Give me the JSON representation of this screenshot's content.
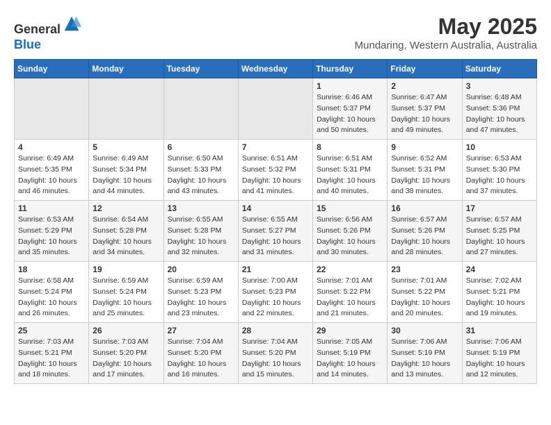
{
  "header": {
    "logo_line1": "General",
    "logo_line2": "Blue",
    "title": "May 2025",
    "subtitle": "Mundaring, Western Australia, Australia"
  },
  "weekdays": [
    "Sunday",
    "Monday",
    "Tuesday",
    "Wednesday",
    "Thursday",
    "Friday",
    "Saturday"
  ],
  "weeks": [
    [
      {
        "day": "",
        "empty": true
      },
      {
        "day": "",
        "empty": true
      },
      {
        "day": "",
        "empty": true
      },
      {
        "day": "",
        "empty": true
      },
      {
        "day": "1",
        "sunrise": "6:46 AM",
        "sunset": "5:37 PM",
        "daylight": "10 hours and 50 minutes."
      },
      {
        "day": "2",
        "sunrise": "6:47 AM",
        "sunset": "5:37 PM",
        "daylight": "10 hours and 49 minutes."
      },
      {
        "day": "3",
        "sunrise": "6:48 AM",
        "sunset": "5:36 PM",
        "daylight": "10 hours and 47 minutes."
      }
    ],
    [
      {
        "day": "4",
        "sunrise": "6:49 AM",
        "sunset": "5:35 PM",
        "daylight": "10 hours and 46 minutes."
      },
      {
        "day": "5",
        "sunrise": "6:49 AM",
        "sunset": "5:34 PM",
        "daylight": "10 hours and 44 minutes."
      },
      {
        "day": "6",
        "sunrise": "6:50 AM",
        "sunset": "5:33 PM",
        "daylight": "10 hours and 43 minutes."
      },
      {
        "day": "7",
        "sunrise": "6:51 AM",
        "sunset": "5:32 PM",
        "daylight": "10 hours and 41 minutes."
      },
      {
        "day": "8",
        "sunrise": "6:51 AM",
        "sunset": "5:31 PM",
        "daylight": "10 hours and 40 minutes."
      },
      {
        "day": "9",
        "sunrise": "6:52 AM",
        "sunset": "5:31 PM",
        "daylight": "10 hours and 38 minutes."
      },
      {
        "day": "10",
        "sunrise": "6:53 AM",
        "sunset": "5:30 PM",
        "daylight": "10 hours and 37 minutes."
      }
    ],
    [
      {
        "day": "11",
        "sunrise": "6:53 AM",
        "sunset": "5:29 PM",
        "daylight": "10 hours and 35 minutes."
      },
      {
        "day": "12",
        "sunrise": "6:54 AM",
        "sunset": "5:28 PM",
        "daylight": "10 hours and 34 minutes."
      },
      {
        "day": "13",
        "sunrise": "6:55 AM",
        "sunset": "5:28 PM",
        "daylight": "10 hours and 32 minutes."
      },
      {
        "day": "14",
        "sunrise": "6:55 AM",
        "sunset": "5:27 PM",
        "daylight": "10 hours and 31 minutes."
      },
      {
        "day": "15",
        "sunrise": "6:56 AM",
        "sunset": "5:26 PM",
        "daylight": "10 hours and 30 minutes."
      },
      {
        "day": "16",
        "sunrise": "6:57 AM",
        "sunset": "5:26 PM",
        "daylight": "10 hours and 28 minutes."
      },
      {
        "day": "17",
        "sunrise": "6:57 AM",
        "sunset": "5:25 PM",
        "daylight": "10 hours and 27 minutes."
      }
    ],
    [
      {
        "day": "18",
        "sunrise": "6:58 AM",
        "sunset": "5:24 PM",
        "daylight": "10 hours and 26 minutes."
      },
      {
        "day": "19",
        "sunrise": "6:59 AM",
        "sunset": "5:24 PM",
        "daylight": "10 hours and 25 minutes."
      },
      {
        "day": "20",
        "sunrise": "6:59 AM",
        "sunset": "5:23 PM",
        "daylight": "10 hours and 23 minutes."
      },
      {
        "day": "21",
        "sunrise": "7:00 AM",
        "sunset": "5:23 PM",
        "daylight": "10 hours and 22 minutes."
      },
      {
        "day": "22",
        "sunrise": "7:01 AM",
        "sunset": "5:22 PM",
        "daylight": "10 hours and 21 minutes."
      },
      {
        "day": "23",
        "sunrise": "7:01 AM",
        "sunset": "5:22 PM",
        "daylight": "10 hours and 20 minutes."
      },
      {
        "day": "24",
        "sunrise": "7:02 AM",
        "sunset": "5:21 PM",
        "daylight": "10 hours and 19 minutes."
      }
    ],
    [
      {
        "day": "25",
        "sunrise": "7:03 AM",
        "sunset": "5:21 PM",
        "daylight": "10 hours and 18 minutes."
      },
      {
        "day": "26",
        "sunrise": "7:03 AM",
        "sunset": "5:20 PM",
        "daylight": "10 hours and 17 minutes."
      },
      {
        "day": "27",
        "sunrise": "7:04 AM",
        "sunset": "5:20 PM",
        "daylight": "10 hours and 16 minutes."
      },
      {
        "day": "28",
        "sunrise": "7:04 AM",
        "sunset": "5:20 PM",
        "daylight": "10 hours and 15 minutes."
      },
      {
        "day": "29",
        "sunrise": "7:05 AM",
        "sunset": "5:19 PM",
        "daylight": "10 hours and 14 minutes."
      },
      {
        "day": "30",
        "sunrise": "7:06 AM",
        "sunset": "5:19 PM",
        "daylight": "10 hours and 13 minutes."
      },
      {
        "day": "31",
        "sunrise": "7:06 AM",
        "sunset": "5:19 PM",
        "daylight": "10 hours and 12 minutes."
      }
    ]
  ]
}
